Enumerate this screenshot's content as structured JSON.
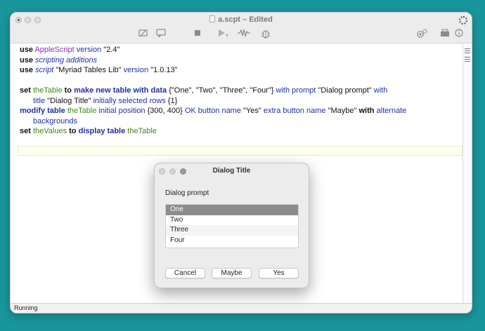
{
  "window": {
    "title": "a.scpt – Edited",
    "status": "Running"
  },
  "toolbar": {
    "icons": [
      "compile-icon",
      "show-log-icon",
      "stop-icon",
      "run-icon",
      "record-icon",
      "bug-icon",
      "settings-icon",
      "library-icon",
      "info-icon"
    ],
    "run_chevron": "▾"
  },
  "code": {
    "l1": {
      "kw": "use",
      "cls": "AppleScript",
      "prop": "version",
      "str": "\"2.4\""
    },
    "l2": {
      "kw": "use",
      "ital": "scripting additions"
    },
    "l3": {
      "kw": "use",
      "ital": "script",
      "str": "\"Myriad Tables Lib\"",
      "prop": "version",
      "str2": "\"1.0.13\""
    },
    "l4": {
      "kw": "set",
      "var": "theTable",
      "kw2": "to",
      "cmd": "make new table with data",
      "list": "{\"One\", \"Two\", \"Three\", \"Four\"}",
      "prop": "with prompt",
      "str": "\"Dialog prompt\"",
      "prop2": "with"
    },
    "l5": {
      "prop": "title",
      "str": "\"Dialog Title\"",
      "prop2": "initially selected rows",
      "list": "{1}"
    },
    "l6": {
      "cmd": "modify table",
      "var": "theTable",
      "prop": "initial position",
      "list": "{300, 400}",
      "prop2": "OK button name",
      "str": "\"Yes\"",
      "prop3": "extra button name",
      "str2": "\"Maybe\"",
      "kw": "with",
      "prop4": "alternate"
    },
    "l7": {
      "prop": "backgrounds"
    },
    "l8": {
      "kw": "set",
      "var": "theValues",
      "kw2": "to",
      "cmd": "display table",
      "var2": "theTable"
    }
  },
  "dialog": {
    "title": "Dialog Title",
    "prompt": "Dialog prompt",
    "rows": [
      "One",
      "Two",
      "Three",
      "Four"
    ],
    "selected_row": 1,
    "buttons": {
      "cancel": "Cancel",
      "maybe": "Maybe",
      "yes": "Yes"
    }
  }
}
